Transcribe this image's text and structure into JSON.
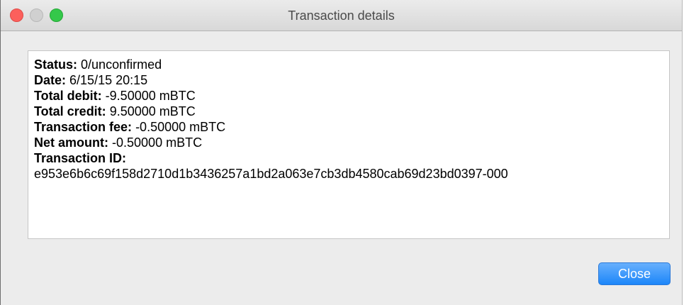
{
  "window": {
    "title": "Transaction details"
  },
  "details": {
    "status_label": "Status:",
    "status_value": "0/unconfirmed",
    "date_label": "Date:",
    "date_value": "6/15/15 20:15",
    "total_debit_label": "Total debit:",
    "total_debit_value": "-9.50000 mBTC",
    "total_credit_label": "Total credit:",
    "total_credit_value": "9.50000 mBTC",
    "fee_label": "Transaction fee:",
    "fee_value": "-0.50000 mBTC",
    "net_label": "Net amount:",
    "net_value": "-0.50000 mBTC",
    "txid_label": "Transaction ID:",
    "txid_value": "e953e6b6c69f158d2710d1b3436257a1bd2a063e7cb3db4580cab69d23bd0397-000"
  },
  "buttons": {
    "close_label": "Close"
  },
  "colors": {
    "accent": "#1c86f9",
    "close_dot": "#fc605c",
    "zoom_dot": "#34c84a",
    "minimize_dot": "#d0d0d0"
  },
  "icons": [
    "close-window-icon",
    "minimize-window-icon",
    "zoom-window-icon"
  ]
}
